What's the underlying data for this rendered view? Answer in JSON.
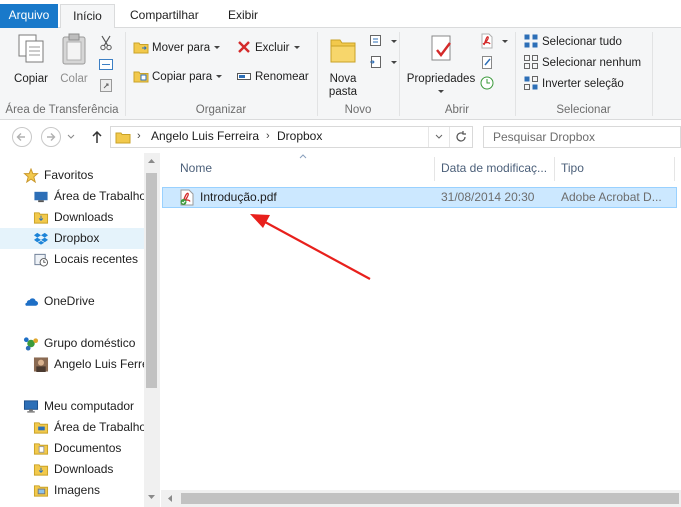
{
  "tabs": {
    "file": "Arquivo",
    "home": "Início",
    "share": "Compartilhar",
    "view": "Exibir"
  },
  "ribbon": {
    "clipboard": {
      "copy": "Copiar",
      "paste": "Colar",
      "group": "Área de Transferência"
    },
    "organize": {
      "move_to": "Mover para",
      "copy_to": "Copiar para",
      "delete": "Excluir",
      "rename": "Renomear",
      "group": "Organizar"
    },
    "new": {
      "new_folder": "Nova pasta",
      "group": "Novo"
    },
    "open": {
      "properties": "Propriedades",
      "group": "Abrir"
    },
    "select": {
      "select_all": "Selecionar tudo",
      "select_none": "Selecionar nenhum",
      "invert": "Inverter seleção",
      "group": "Selecionar"
    }
  },
  "address": {
    "path": [
      "Angelo Luis Ferreira",
      "Dropbox"
    ],
    "search_placeholder": "Pesquisar Dropbox"
  },
  "nav": {
    "favorites": "Favoritos",
    "desktop": "Área de Trabalho",
    "downloads": "Downloads",
    "dropbox": "Dropbox",
    "recent": "Locais recentes",
    "onedrive": "OneDrive",
    "homegroup": "Grupo doméstico",
    "user": "Angelo Luis Ferreira",
    "computer": "Meu computador",
    "pc_desktop": "Área de Trabalho",
    "documents": "Documentos",
    "pc_downloads": "Downloads",
    "images": "Imagens"
  },
  "columns": {
    "name": "Nome",
    "date": "Data de modificaç...",
    "type": "Tipo"
  },
  "files": [
    {
      "name": "Introdução.pdf",
      "date": "31/08/2014 20:30",
      "type": "Adobe Acrobat D..."
    }
  ],
  "colors": {
    "accent": "#1979ca",
    "selection": "#cce8ff",
    "annotation_arrow": "#e8201c"
  }
}
